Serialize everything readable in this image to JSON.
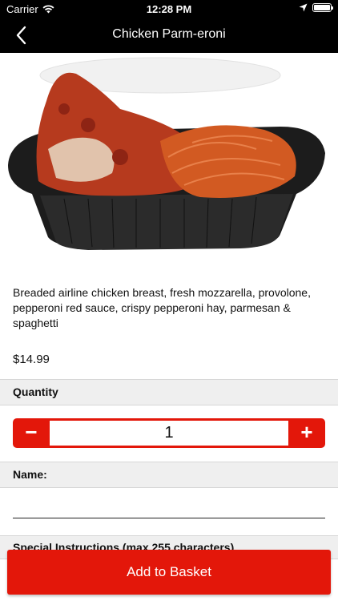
{
  "status_bar": {
    "carrier": "Carrier",
    "time": "12:28 PM",
    "battery_level": 1.0
  },
  "navbar": {
    "title": "Chicken Parm-eroni"
  },
  "item": {
    "description": "Breaded airline chicken breast, fresh mozzarella, provolone, pepperoni red sauce, crispy pepperoni hay, parmesan & spaghetti",
    "price": "$14.99"
  },
  "quantity": {
    "label": "Quantity",
    "value": "1",
    "minus": "−",
    "plus": "+"
  },
  "name": {
    "label": "Name:",
    "value": ""
  },
  "special": {
    "label": "Special Instructions (max 255 characters)"
  },
  "add_button": {
    "label": "Add to Basket"
  },
  "colors": {
    "accent": "#e3170a",
    "bar": "#000000",
    "section_bg": "#efefef"
  }
}
